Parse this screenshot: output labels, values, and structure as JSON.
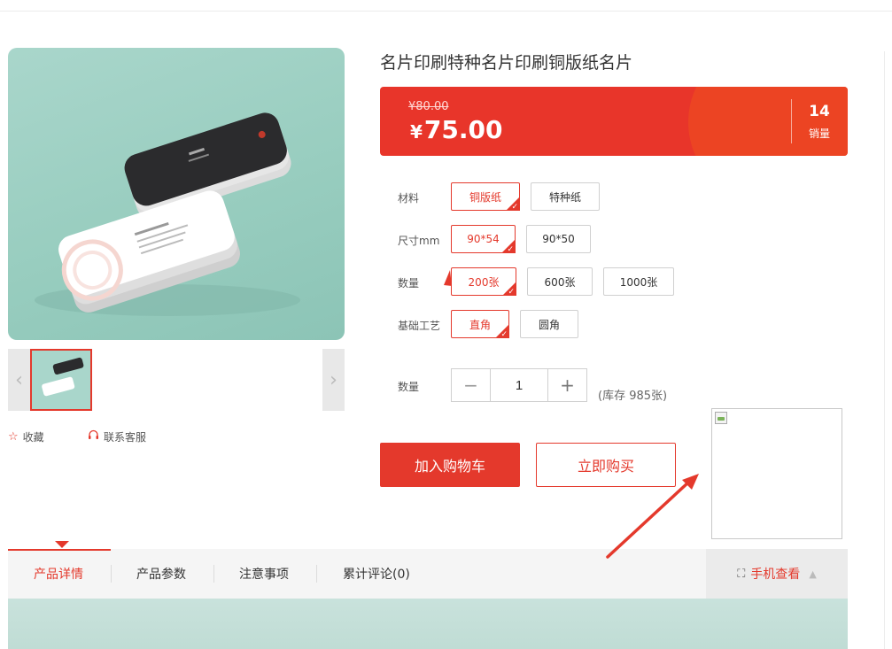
{
  "product": {
    "title": "名片印刷特种名片印刷铜版纸名片",
    "price": {
      "old": "¥80.00",
      "currency_symbol": "¥",
      "current": "75.00",
      "sales_count": "14",
      "sales_label": "销量"
    },
    "options": [
      {
        "label": "材料",
        "choices": [
          "铜版纸",
          "特种纸"
        ],
        "selected": "铜版纸"
      },
      {
        "label": "尺寸mm",
        "choices": [
          "90*54",
          "90*50"
        ],
        "selected": "90*54"
      },
      {
        "label": "数量",
        "choices": [
          "200张",
          "600张",
          "1000张"
        ],
        "selected": "200张"
      },
      {
        "label": "基础工艺",
        "choices": [
          "直角",
          "圆角"
        ],
        "selected": "直角"
      }
    ],
    "quantity": {
      "label": "数量",
      "minus": "−",
      "plus": "+",
      "value": "1",
      "stock": "(库存 985张)"
    },
    "buttons": {
      "add_to_cart": "加入购物车",
      "buy_now": "立即购买"
    }
  },
  "gallery": {
    "prev_icon": "chevron-left-icon",
    "next_icon": "chevron-right-icon",
    "prev_glyph": "‹",
    "next_glyph": "›",
    "favorite_label": "收藏",
    "favorite_icon": "star-outline-icon",
    "service_label": "联系客服",
    "service_icon": "headset-icon"
  },
  "tabs": {
    "items": [
      "产品详情",
      "产品参数",
      "注意事项",
      "累计评论(0)"
    ],
    "active": "产品详情",
    "mobile_view": "手机查看",
    "mobile_view_icon": "scan-icon",
    "collapse_icon": "triangle-up-icon"
  },
  "colors": {
    "accent": "#e4392c",
    "price_bg": "#e8352a",
    "image_bg": "#a9d6cb"
  }
}
